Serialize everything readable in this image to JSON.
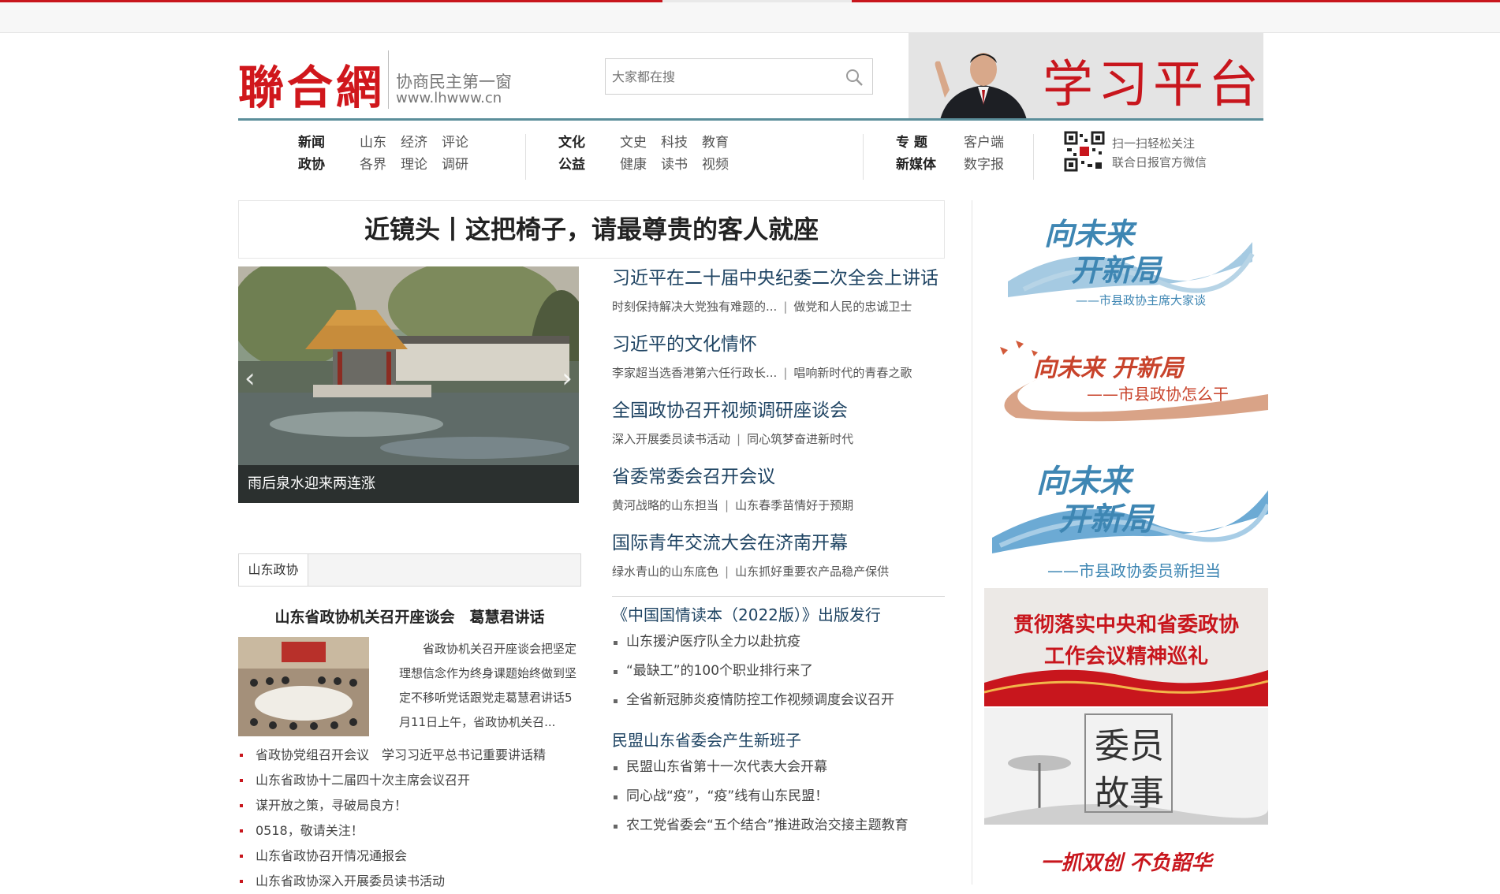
{
  "header": {
    "logo_text": "聯合網",
    "slogan": "协商民主第一窗",
    "url": "www.lhwww.cn",
    "search_placeholder": "大家都在搜",
    "banner_text": "学习平台"
  },
  "nav": {
    "groups": [
      {
        "rows": [
          {
            "lead": "新闻",
            "items": [
              "山东",
              "经济",
              "评论"
            ]
          },
          {
            "lead": "政协",
            "items": [
              "各界",
              "理论",
              "调研"
            ]
          }
        ]
      },
      {
        "rows": [
          {
            "lead": "文化",
            "items": [
              "文史",
              "科技",
              "教育"
            ]
          },
          {
            "lead": "公益",
            "items": [
              "健康",
              "读书",
              "视频"
            ]
          }
        ]
      },
      {
        "rows": [
          {
            "lead": "专 题",
            "items": [
              "客户端"
            ]
          },
          {
            "lead": "新媒体",
            "items": [
              "数字报"
            ]
          }
        ]
      }
    ],
    "qr_line1": "扫一扫轻松关注",
    "qr_line2": "联合日报官方微信"
  },
  "headline": "近镜头丨这把椅子，请最尊贵的客人就座",
  "slider": {
    "caption": "雨后泉水迎来两连涨",
    "prev": "‹",
    "next": "›"
  },
  "news": [
    {
      "title": "习近平在二十届中央纪委二次全会上讲话",
      "sub1": "时刻保持解决大党独有难题的...",
      "sub2": "做党和人民的忠诚卫士"
    },
    {
      "title": "习近平的文化情怀",
      "sub1": "李家超当选香港第六任行政长...",
      "sub2": "唱响新时代的青春之歌"
    },
    {
      "title": "全国政协召开视频调研座谈会",
      "sub1": "深入开展委员读书活动",
      "sub2": "同心筑梦奋进新时代"
    },
    {
      "title": "省委常委会召开会议",
      "sub1": "黄河战略的山东担当",
      "sub2": "山东春季苗情好于预期"
    },
    {
      "title": "国际青年交流大会在济南开幕",
      "sub1": "绿水青山的山东底色",
      "sub2": "山东抓好重要农产品稳产保供"
    }
  ],
  "news2": {
    "g1_title": "《中国国情读本（2022版）》出版发行",
    "g1_items": [
      "山东援沪医疗队全力以赴抗疫",
      "“最缺工”的100个职业排行来了",
      "全省新冠肺炎疫情防控工作视频调度会议召开"
    ],
    "g2_title": "民盟山东省委会产生新班子",
    "g2_items": [
      "民盟山东省第十一次代表大会开幕",
      "同心战“疫”，“疫”线有山东民盟！",
      "农工党省委会“五个结合”推进政治交接主题教育"
    ]
  },
  "left": {
    "tab": "山东政协",
    "title": "山东省政协机关召开座谈会　葛慧君讲话",
    "desc": "省政协机关召开座谈会把坚定理想信念作为终身课题始终做到坚定不移听党话跟党走葛慧君讲话5月11日上午，省政协机关召...",
    "list": [
      "省政协党组召开会议　学习习近平总书记重要讲话精",
      "山东省政协十二届四十次主席会议召开",
      "谋开放之策，寻破局良方！",
      "0518，敬请关注！",
      "山东省政协召开情况通报会",
      "山东省政协深入开展委员读书活动"
    ]
  },
  "right": {
    "b1_l1": "向未来",
    "b1_l2": "开新局",
    "b1_sub": "——市县政协主席大家谈",
    "b2_main": "向未来 开新局",
    "b2_sub": "——市县政协怎么干",
    "b3_l1": "向未来",
    "b3_l2": "开新局",
    "b3_sub": "——市县政协委员新担当",
    "b4_l1": "贯彻落实中央和省委政协",
    "b4_l2": "工作会议精神巡礼",
    "b5_l1": "委员",
    "b5_l2": "故事",
    "b6": "一抓双创 不负韶华"
  },
  "colors": {
    "brand_red": "#c8161d",
    "link_blue": "#1f4463",
    "teal_rule": "#5b8e9a",
    "banner_blue": "#3e86b3"
  }
}
